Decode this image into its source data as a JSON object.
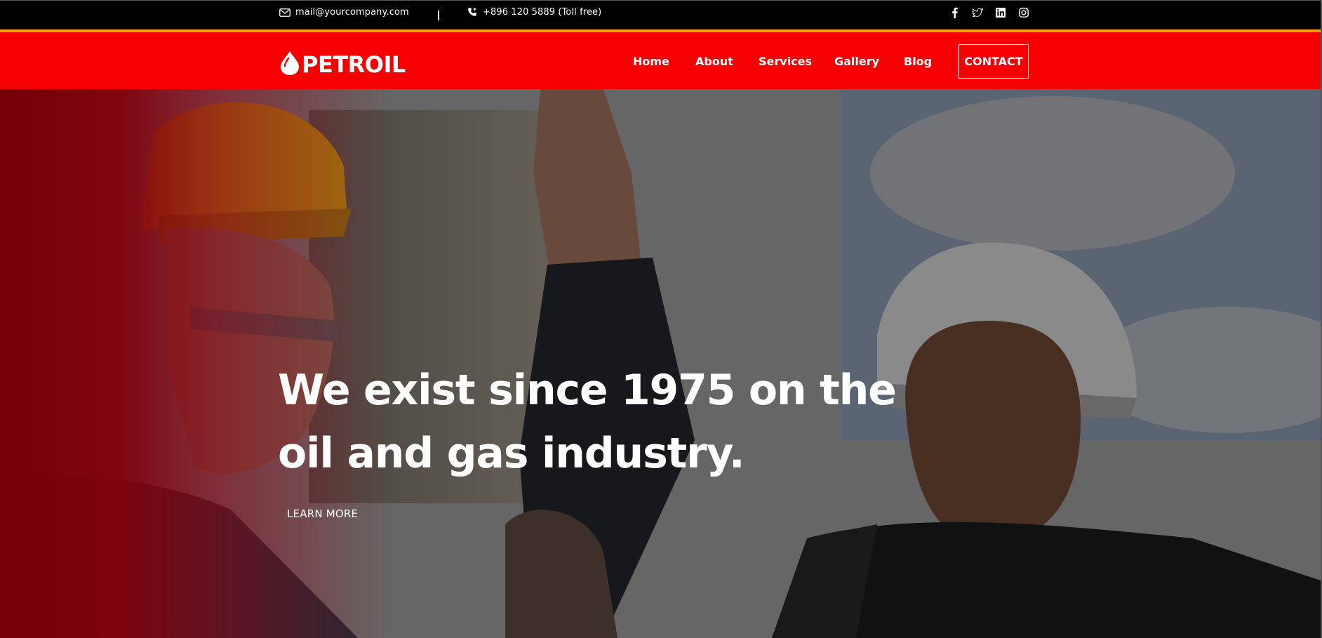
{
  "topbar": {
    "email": "mail@yourcompany.com",
    "phone": "+896 120 5889 (Toll free)",
    "email_icon": "mail-icon",
    "phone_icon": "phone-icon",
    "social": [
      "facebook-icon",
      "twitter-icon",
      "linkedin-icon",
      "instagram-icon"
    ],
    "accent_color": "#f5a000"
  },
  "navbar": {
    "logo_text": "PETROIL",
    "links": [
      "Home",
      "About",
      "Services",
      "Gallery",
      "Blog"
    ],
    "cta_label": "CONTACT",
    "bg_color": "#f50003"
  },
  "hero": {
    "headline_line1": "We exist since 1975 on the",
    "headline_line2": "oil and gas industry.",
    "cta_label": "LEARN MORE"
  }
}
